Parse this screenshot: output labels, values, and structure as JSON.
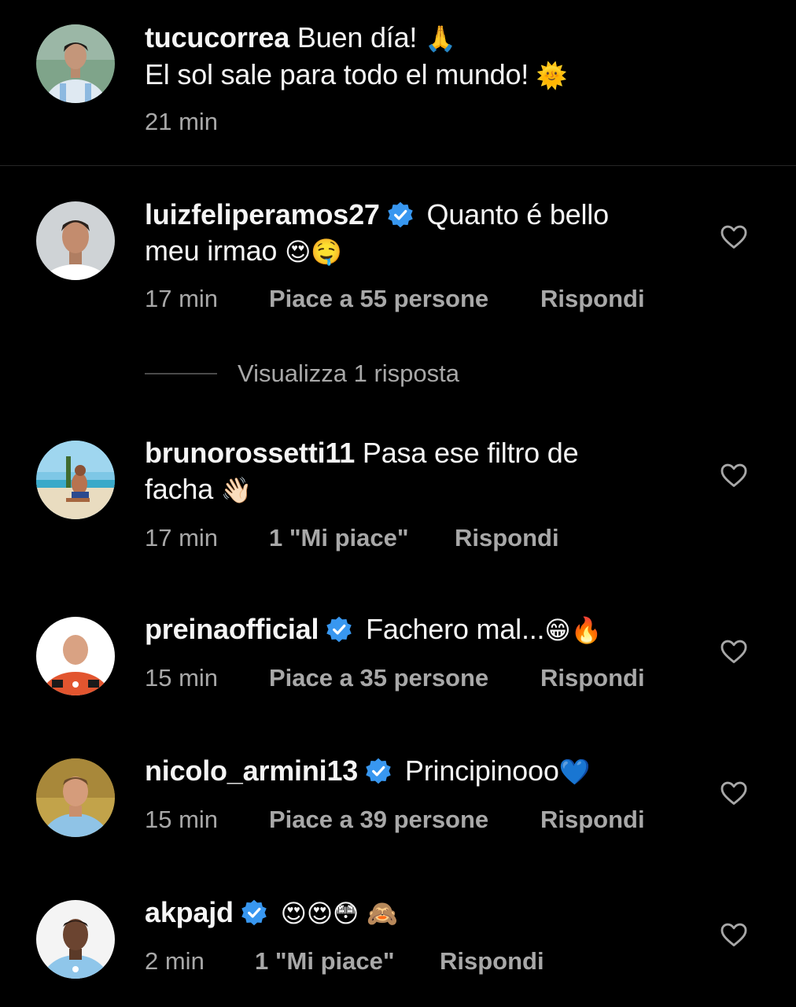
{
  "caption": {
    "username": "tucucorrea",
    "text_line1": "Buen día!",
    "emoji1": "🙏",
    "text_line2": "El sol sale para todo el mundo!",
    "emoji2": "🌞",
    "time": "21 min"
  },
  "comments": [
    {
      "username": "luizfeliperamos27",
      "verified": true,
      "text": "Quanto é bello",
      "text_line2": "meu irmao",
      "emojis": "😍🤤",
      "time": "17 min",
      "likes": "Piace a 55 persone",
      "reply_label": "Rispondi",
      "view_replies": "Visualizza 1 risposta"
    },
    {
      "username": "brunorossetti11",
      "verified": false,
      "text": "Pasa ese filtro de",
      "text_line2": "facha",
      "emojis": "👋🏻",
      "time": "17 min",
      "likes": "1 \"Mi piace\"",
      "reply_label": "Rispondi"
    },
    {
      "username": "preinaofficial",
      "verified": true,
      "text": "Fachero mal...",
      "emojis": "😁🔥",
      "time": "15 min",
      "likes": "Piace a 35 persone",
      "reply_label": "Rispondi"
    },
    {
      "username": "nicolo_armini13",
      "verified": true,
      "text": "Principinooo",
      "emojis": "💙",
      "time": "15 min",
      "likes": "Piace a 39 persone",
      "reply_label": "Rispondi"
    },
    {
      "username": "akpajd",
      "verified": true,
      "text": "",
      "emojis": "😍😍😳 🙈",
      "time": "2 min",
      "likes": "1 \"Mi piace\"",
      "reply_label": "Rispondi"
    }
  ],
  "icons": {
    "verified": "verified-badge-icon",
    "like": "heart-outline-icon"
  },
  "colors": {
    "background": "#000000",
    "text": "#f5f5f5",
    "secondary": "#a8a8a8",
    "verified": "#3897f0"
  }
}
